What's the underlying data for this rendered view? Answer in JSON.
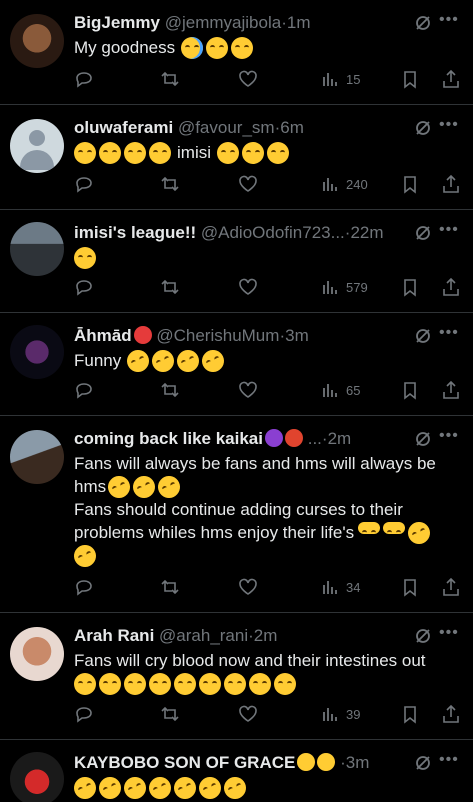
{
  "colors": {
    "background": "#000000",
    "text": "#e7e9ea",
    "muted": "#71767b",
    "divider": "#2f3336"
  },
  "icons": {
    "reply": "reply-icon",
    "retweet": "retweet-icon",
    "like": "heart-icon",
    "views": "views-chart-icon",
    "bookmark": "bookmark-icon",
    "share": "share-icon",
    "grok": "grok-icon",
    "more": "more-icon"
  },
  "tweets": [
    {
      "name": "BigJemmy",
      "handle": "@jemmyajibola",
      "dot": "·",
      "time": "1m",
      "lines": [
        "My goodness"
      ],
      "emojis": 3,
      "views": "15"
    },
    {
      "name": "oluwaferami",
      "handle": "@favour_sm",
      "dot": "·",
      "time": "6m",
      "lines": [
        "imisi"
      ],
      "emojis": 7,
      "views": "240"
    },
    {
      "name": "imisi's league!!",
      "handle": "@AdioOdofin723...",
      "dot": "·",
      "time": "22m",
      "lines": [],
      "emojis": 1,
      "views": "579"
    },
    {
      "name": "Āhmād",
      "handle": "@CherishuMum",
      "dot": "·",
      "time": "3m",
      "lines": [
        "Funny"
      ],
      "emojis": 4,
      "views": "65"
    },
    {
      "name": "coming back like kaikai",
      "handle": "...",
      "dot": "·",
      "time": "2m",
      "lines": [
        "Fans will always be fans and hms will always be",
        "hms",
        "Fans should continue adding curses to their",
        "problems whiles hms enjoy their life's"
      ],
      "emojis": 6,
      "views": "34"
    },
    {
      "name": "Arah Rani",
      "handle": "@arah_rani",
      "dot": "·",
      "time": "2m",
      "lines": [
        "Fans will cry blood now and their intestines out"
      ],
      "emojis": 9,
      "views": "39"
    },
    {
      "name": "KAYBOBO SON OF GRACE",
      "handle": "",
      "dot": "·",
      "time": "3m",
      "lines": [],
      "emojis": 7,
      "views": ""
    }
  ]
}
